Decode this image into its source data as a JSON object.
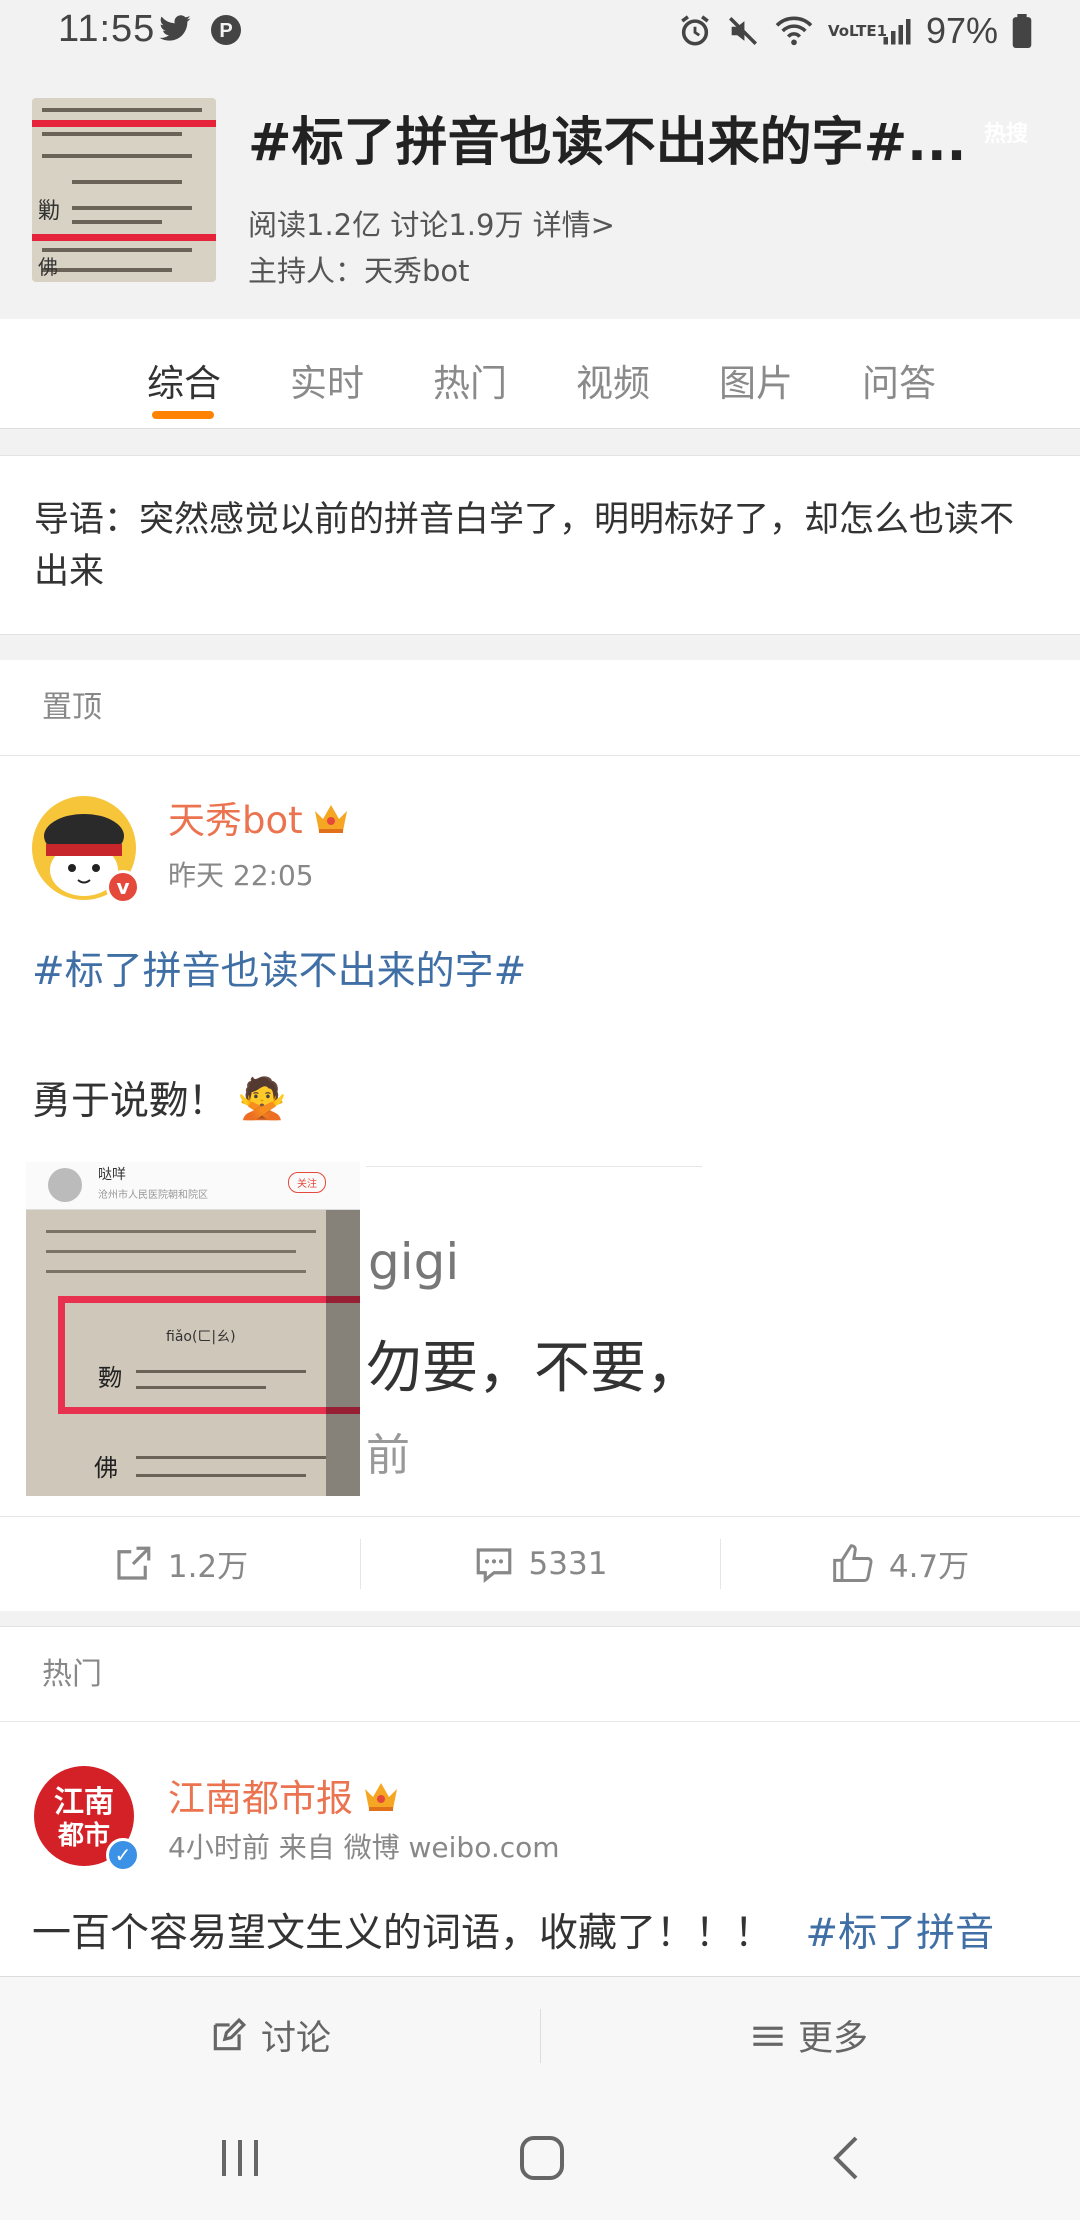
{
  "status_bar": {
    "time": "11:55",
    "battery": "97%",
    "network_label": "VoLTE1"
  },
  "topic": {
    "title": "#标了拼音也读不出来的字#...",
    "hot_badge": "热搜",
    "stats": "阅读1.2亿 讨论1.9万 详情>",
    "host": "主持人：天秀bot"
  },
  "tabs": [
    {
      "label": "综合",
      "active": true
    },
    {
      "label": "实时",
      "active": false
    },
    {
      "label": "热门",
      "active": false
    },
    {
      "label": "视频",
      "active": false
    },
    {
      "label": "图片",
      "active": false
    },
    {
      "label": "问答",
      "active": false
    }
  ],
  "intro": {
    "text": "导语：突然感觉以前的拼音白学了，明明标好了，却怎么也读不出来"
  },
  "pinned_section": {
    "label": "置顶"
  },
  "pinned_post": {
    "author": "天秀bot",
    "time": "昨天 22:05",
    "hashtag": "#标了拼音也读不出来的字#",
    "text": "勇于说覅！",
    "emoji": "🙅",
    "image_left": {
      "username": "哒咩",
      "location": "沧州市人民医院朝和院区",
      "follow": "关注",
      "pinyin": "fiǎo(ㄈ|ㄠ)",
      "char_1": "覅",
      "char_2": "佛"
    },
    "image_right": {
      "line1": "gigi",
      "line2": "勿要，不要，",
      "line3": "前"
    },
    "reposts": "1.2万",
    "comments": "5331",
    "likes": "4.7万"
  },
  "hot_section": {
    "label": "热门"
  },
  "hot_post": {
    "author": "江南都市报",
    "meta": "4小时前 来自 微博 weibo.com",
    "text": "一百个容易望文生义的词语，收藏了！！！",
    "hashtag": "#标了拼音"
  },
  "bottom_bar": {
    "discuss": "讨论",
    "more": "更多"
  },
  "colors": {
    "accent": "#ff8200",
    "author": "#eb7350",
    "link": "#3f6fa5"
  }
}
